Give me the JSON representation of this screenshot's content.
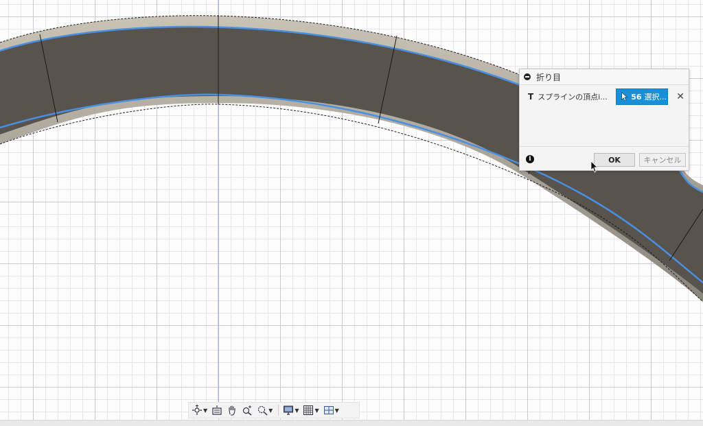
{
  "dialog": {
    "title": "折り目",
    "row_icon_label": "T",
    "row_label": "スプラインの頂点",
    "row_label_ellipsis": "スプラインの頂点i...",
    "selection_count": "56",
    "selection_label": "選択...",
    "ok_label": "OK",
    "cancel_label": "キャンセル"
  },
  "icons": {
    "collapse": "collapse-icon",
    "select_cursor": "arrow-cursor-icon",
    "close": "close-icon",
    "info": "info-icon"
  },
  "navbar": {
    "items": [
      "orbit-icon",
      "look-at-icon",
      "pan-icon",
      "zoom-icon",
      "fit-icon",
      "display-settings-icon",
      "grid-settings-icon",
      "viewports-icon"
    ]
  },
  "colors": {
    "selection_blue": "#1a8fd8",
    "edge_highlight": "#4a90e2",
    "body_fill": "#58534d"
  }
}
